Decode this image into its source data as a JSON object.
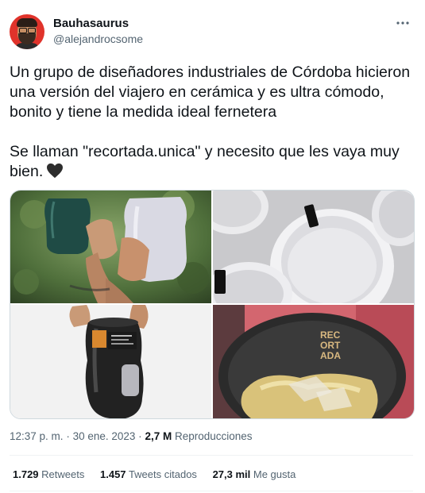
{
  "author": {
    "display_name": "Bauhasaurus",
    "handle": "@alejandrocsome"
  },
  "more_icon": "more-horizontal-icon",
  "tweet": {
    "text": "Un grupo de diseñadores industriales de Córdoba hicieron una versión del viajero en cerámica y es ultra cómodo, bonito y tiene la medida ideal fernetera\n\nSe llaman \"recortada.unica\" y necesito que les vaya muy bien.",
    "emoji": "black-heart"
  },
  "media": {
    "cup_logo_text": "REC ORT ADA"
  },
  "meta": {
    "time": "12:37 p. m.",
    "separator": "·",
    "date": "30 ene. 2023",
    "views_count": "2,7 M",
    "views_label": "Reproducciones"
  },
  "stats": {
    "retweets_count": "1.729",
    "retweets_label": "Retweets",
    "quotes_count": "1.457",
    "quotes_label": "Tweets citados",
    "likes_count": "27,3 mil",
    "likes_label": "Me gusta"
  },
  "colors": {
    "text": "#0f1419",
    "secondary": "#536471",
    "border": "#cfd9de",
    "avatar_bg": "#e0332b"
  }
}
